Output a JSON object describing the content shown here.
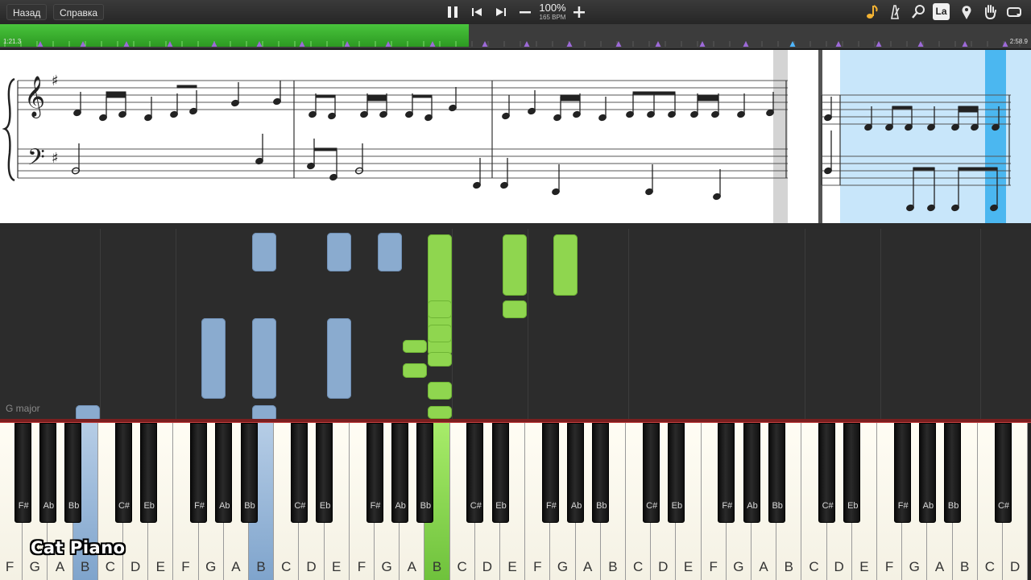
{
  "toolbar": {
    "back_label": "Назад",
    "help_label": "Справка",
    "zoom": "100%",
    "tempo": "165 BPM",
    "la_label": "La"
  },
  "timeline": {
    "elapsed": "1:21.3",
    "total": "2:58.9",
    "progress": 0.455
  },
  "colors": {
    "left_hand": "#8aabcf",
    "right_hand": "#8fd64f",
    "progress": "#3fb932",
    "key_signature_band": "#c8e6fa"
  },
  "key_signature": "G major",
  "keyboard": {
    "white_keys": [
      "F",
      "G",
      "A",
      "B",
      "C",
      "D",
      "E",
      "F",
      "G",
      "A",
      "B",
      "C",
      "D",
      "E",
      "F",
      "G",
      "A",
      "B",
      "C",
      "D",
      "E",
      "F",
      "G",
      "A",
      "B",
      "C",
      "D",
      "E",
      "F",
      "G",
      "A",
      "B",
      "C",
      "D",
      "E",
      "F",
      "G",
      "A",
      "B",
      "C",
      "D"
    ],
    "black_keys": [
      "F#",
      "Ab",
      "Bb",
      "C#",
      "Eb",
      "F#",
      "Ab",
      "Bb",
      "C#",
      "Eb",
      "F#",
      "Ab",
      "Bb",
      "C#",
      "Eb",
      "F#",
      "Ab",
      "Bb",
      "C#",
      "Eb",
      "F#",
      "Ab",
      "Bb",
      "C#",
      "Eb",
      "F#",
      "Ab",
      "Bb",
      "C#",
      "Eb",
      "F#",
      "Ab",
      "Bb",
      "C#"
    ],
    "pressed_blue": [
      3,
      10
    ],
    "pressed_green": [
      17
    ]
  },
  "watermark": "Cat Piano",
  "icons": [
    "pause-icon",
    "skip-back-icon",
    "skip-forward-icon",
    "minus-icon",
    "plus-icon",
    "note-icon",
    "metronome-icon",
    "magnifier-icon",
    "la-icon",
    "location-pin-icon",
    "hand-icon",
    "loop-icon"
  ]
}
